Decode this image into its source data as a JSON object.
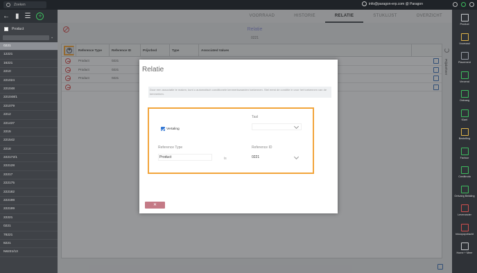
{
  "topbar": {
    "search_placeholder": "Zoeken",
    "user_email": "info@paragon-erp.com @ Paragon"
  },
  "sidebar": {
    "filter_label": "Product",
    "items": [
      "0221",
      "12221",
      "16221",
      "2210",
      "221024",
      "221048",
      "221048/1",
      "221079",
      "2212",
      "221437",
      "2215",
      "221542",
      "2218",
      "222172/1",
      "222128",
      "22217",
      "222175",
      "222182",
      "222198",
      "222199",
      "22221",
      "0221",
      "78221",
      "8221",
      "N6221/13"
    ],
    "active_index": 0
  },
  "tabs": [
    {
      "label": "VOORRAAD",
      "active": false
    },
    {
      "label": "HISTORIE",
      "active": false
    },
    {
      "label": "RELATIE",
      "active": true
    },
    {
      "label": "STUKLIJST",
      "active": false
    },
    {
      "label": "OVERZICHT",
      "active": false
    }
  ],
  "main": {
    "title": "Relatie",
    "subtitle": "0221",
    "columns": [
      "Reference Type",
      "Reference ID",
      "Prijsrbod",
      "Type",
      "Associated Values"
    ],
    "rows": [
      {
        "type": "Product",
        "id": "0221"
      },
      {
        "type": "Product",
        "id": "0221"
      },
      {
        "type": "Product",
        "id": "0221"
      },
      {
        "type": "",
        "id": ""
      }
    ],
    "side_tab": "Prijsbeheer"
  },
  "modal": {
    "title": "Relatie",
    "info": "Door een associatie te maken, kunt u automatisch conditionele kenmerkwaarden toekennen. Stel eerst de conditie in voor het toekennen van de kenmerken.",
    "checkbox_label": "Vertaling",
    "checkbox_checked": true,
    "taal_label": "Taal",
    "taal_value": "",
    "ref_type_label": "Reference Type",
    "ref_type_value": "Product",
    "is_label": "is",
    "ref_id_label": "Reference ID",
    "ref_id_value": "0221",
    "delete_label": "✕"
  },
  "right_sidebar": [
    {
      "label": "Product",
      "color": "#c7c9cc"
    },
    {
      "label": "Voorraad",
      "color": "#e0b44a"
    },
    {
      "label": "Placement",
      "color": "#9aa0a8"
    },
    {
      "label": "Verzend",
      "color": "#3ebd5f"
    },
    {
      "label": "Ontvang",
      "color": "#3ebd5f"
    },
    {
      "label": "Klant",
      "color": "#3ebd5f"
    },
    {
      "label": "Bestelling",
      "color": "#e0b44a"
    },
    {
      "label": "Factuur",
      "color": "#3ebd5f"
    },
    {
      "label": "Creditnota",
      "color": "#3ebd5f"
    },
    {
      "label": "Ontvang Betaling",
      "color": "#3ebd5f"
    },
    {
      "label": "Leverancier",
      "color": "#d04f4f"
    },
    {
      "label": "Inkoopopdracht",
      "color": "#d04f4f"
    },
    {
      "label": "Home + Meer",
      "color": "#c7c9cc"
    }
  ]
}
